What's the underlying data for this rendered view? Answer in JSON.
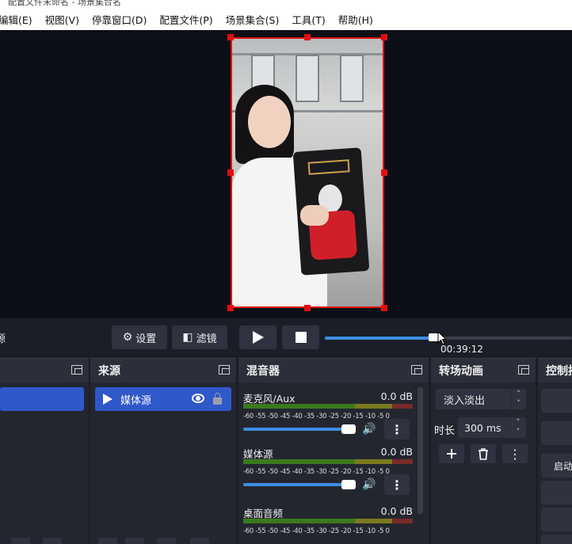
{
  "window": {
    "title_fragment": "配置文件未命名 - 场景集合名"
  },
  "menu": [
    {
      "label": "编辑(E)"
    },
    {
      "label": "视图(V)"
    },
    {
      "label": "停靠窗口(D)"
    },
    {
      "label": "配置文件(P)"
    },
    {
      "label": "场景集合(S)"
    },
    {
      "label": "工具(T)"
    },
    {
      "label": "帮助(H)"
    }
  ],
  "toolbar": {
    "source_label_fragment": "源",
    "settings_label": "设置",
    "filters_label": "滤镜",
    "seek_time": "00:39:12",
    "seek_progress": 0.44
  },
  "docks": {
    "scenes": {
      "title": ""
    },
    "sources": {
      "title": "来源",
      "items": [
        {
          "name": "媒体源"
        }
      ]
    },
    "mixer": {
      "title": "混音器",
      "ticks": "-60 -55 -50 -45 -40 -35 -30 -25 -20 -15 -10 -5  0",
      "channels": [
        {
          "name": "麦克风/Aux",
          "db": "0.0 dB",
          "volume": 0.82
        },
        {
          "name": "媒体源",
          "db": "0.0 dB",
          "volume": 0.82
        },
        {
          "name": "桌面音频",
          "db": "0.0 dB",
          "volume": 0.82
        }
      ]
    },
    "transitions": {
      "title": "转场动画",
      "selected": "淡入淡出",
      "duration_label": "时长",
      "duration_value": "300 ms"
    },
    "controls": {
      "title": "控制按",
      "start_label_fragment": "启动"
    }
  },
  "colors": {
    "accent": "#3d8fe3",
    "selection": "#2f58c9",
    "bounding_box": "#e01010",
    "panel": "#24262f",
    "preview_bg": "#0d0f16"
  },
  "icons": {
    "settings": "gear-icon",
    "filters": "filter-icon",
    "play": "play-icon",
    "stop": "stop-icon",
    "visibility": "eye-icon",
    "lock": "lock-icon",
    "speaker": "speaker-icon",
    "menu": "kebab-icon",
    "add": "plus-icon",
    "remove": "trash-icon",
    "float": "float-dock-icon"
  }
}
